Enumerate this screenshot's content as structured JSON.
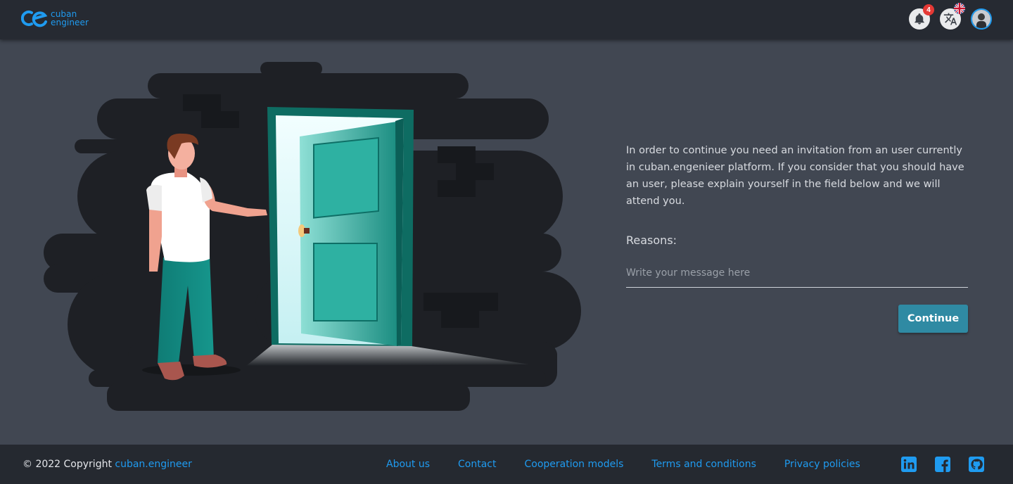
{
  "header": {
    "logo": {
      "line1": "cuban",
      "line2": "engineer"
    },
    "notifications": {
      "icon": "bell-icon",
      "count": "4"
    },
    "language": {
      "icon": "translate-icon",
      "flag": "uk-flag-icon"
    },
    "avatar": {
      "icon": "user-avatar"
    }
  },
  "main": {
    "intro": "In order to continue you need an invitation from an user currently in cuban.engenieer platform. If you consider that you should have an user, please explain yourself in the field below and we will attend you.",
    "reasons_label": "Reasons:",
    "message": {
      "placeholder": "Write your message here",
      "value": ""
    },
    "continue_label": "Continue"
  },
  "footer": {
    "copyright_text": "© 2022 Copyright",
    "copyright_link": "cuban.engineer",
    "links": [
      "About us",
      "Contact",
      "Cooperation models",
      "Terms and conditions",
      "Privacy policies"
    ],
    "socials": [
      "linkedin-icon",
      "facebook-icon",
      "github-icon"
    ]
  },
  "colors": {
    "accent": "#1f9bf0",
    "header_bg": "#262a32",
    "page_bg": "#414752",
    "button_bg": "#2f8aa3",
    "badge": "#e53935"
  }
}
